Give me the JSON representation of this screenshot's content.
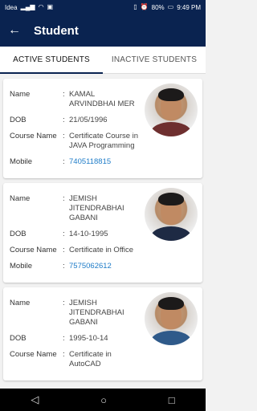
{
  "status_bar": {
    "carrier": "Idea",
    "battery": "80%",
    "time": "9:49 PM"
  },
  "app_bar": {
    "title": "Student"
  },
  "tabs": [
    {
      "label": "ACTIVE STUDENTS",
      "active": true
    },
    {
      "label": "INACTIVE STUDENTS",
      "active": false
    }
  ],
  "labels": {
    "name": "Name",
    "dob": "DOB",
    "course": "Course Name",
    "mobile": "Mobile"
  },
  "students": [
    {
      "name": "KAMAL ARVINDBHAI MER",
      "dob": "21/05/1996",
      "course": "Certificate Course in JAVA Programming",
      "mobile": "7405118815"
    },
    {
      "name": "JEMISH JITENDRABHAI GABANI",
      "dob": "14-10-1995",
      "course": "Certificate in Office",
      "mobile": "7575062612"
    },
    {
      "name": "JEMISH JITENDRABHAI GABANI",
      "dob": "1995-10-14",
      "course": "Certificate in AutoCAD",
      "mobile": ""
    }
  ],
  "colors": {
    "primary": "#0a2350",
    "link": "#1e7cc8"
  }
}
